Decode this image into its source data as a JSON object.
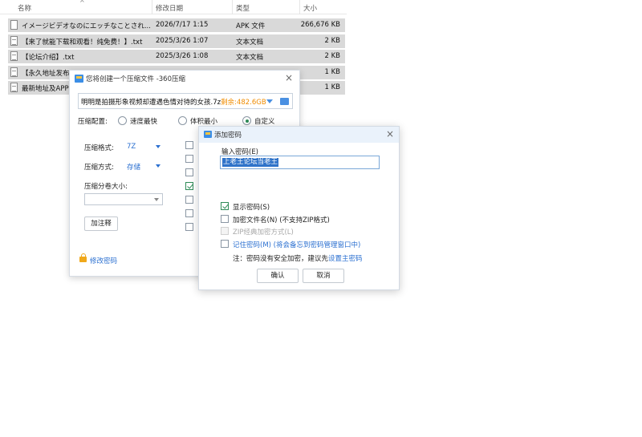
{
  "explorer": {
    "columns": {
      "name": "名称",
      "modified": "修改日期",
      "type": "类型",
      "size": "大小"
    },
    "sort_arrow": "^",
    "rows": [
      {
        "name": "イメージビデオなのにエッチなことされ...",
        "modified": "2026/7/17 1:15",
        "type": "APK 文件",
        "size": "266,676 KB"
      },
      {
        "name": "【来了就能下载和观看！纯免费！】.txt",
        "modified": "2025/3/26 1:07",
        "type": "文本文档",
        "size": "2 KB"
      },
      {
        "name": "【论坛介绍】.txt",
        "modified": "2025/3/26 1:08",
        "type": "文本文档",
        "size": "2 KB"
      },
      {
        "name": "【永久地址发布页",
        "modified": "",
        "type": "",
        "size": "1 KB"
      },
      {
        "name": "最新地址及APP",
        "modified": "",
        "type": "",
        "size": "1 KB"
      }
    ]
  },
  "compress_dialog": {
    "title": "您将创建一个压缩文件 -360压缩",
    "close": "×",
    "path": "明明是拍摄形象视频却遭遇色情对待的女孩.7z",
    "free_space": "剩余:482.6GB",
    "config_label": "压缩配置:",
    "options": {
      "fastest": "速度最快",
      "smallest": "体积最小",
      "custom": "自定义"
    },
    "format_label": "压缩格式:",
    "format_value": "7Z",
    "method_label": "压缩方式:",
    "method_value": "存储",
    "split_label": "压缩分卷大小:",
    "split_value": "",
    "comment_button": "加注释",
    "change_password": "修改密码"
  },
  "password_dialog": {
    "title": "添加密码",
    "close": "×",
    "input_label": "输入密码(E)",
    "input_value": "上老王论坛当老王",
    "show_password": "显示密码(S)",
    "encrypt_names": "加密文件名(N) (不支持ZIP格式)",
    "zip_classic": "ZIP经典加密方式(L)",
    "remember_password": "记住密码(M) (将会备忘到密码管理窗口中)",
    "note_prefix": "注：密码没有安全加密，建议先",
    "note_link": "设置主密码",
    "ok_button": "确认",
    "cancel_button": "取消"
  },
  "colors": {
    "accent": "#2a6fd0",
    "orange": "#f08c00",
    "selection": "#2f73c9",
    "check": "#2e8b57"
  }
}
